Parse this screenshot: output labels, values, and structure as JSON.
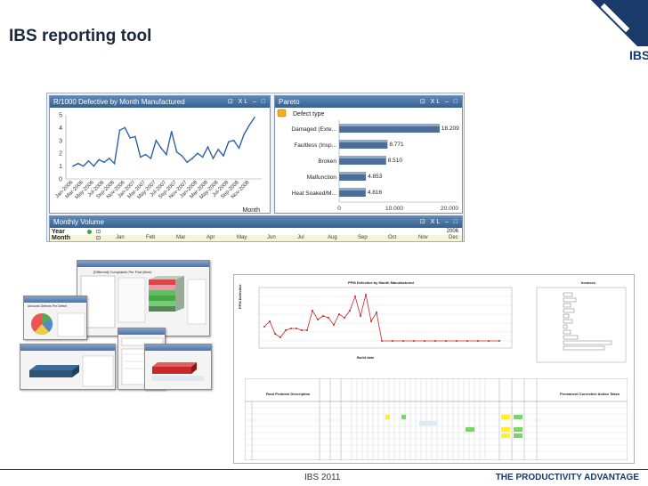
{
  "slide": {
    "title": "IBS reporting tool"
  },
  "logo": {
    "text": "IBS",
    "color": "#1a3a6a"
  },
  "qlikview": {
    "defective_panel": {
      "title": "R/1000 Defective by Month Manufactured",
      "icons": "⊡ XL ‒ □",
      "x_axis_label": "Month",
      "y_ticks": [
        "5",
        "4",
        "3",
        "2",
        "1",
        "0"
      ],
      "x_ticks": [
        "Jan-2006",
        "Mar-2006",
        "May-2006",
        "Jul-2006",
        "Sep-2006",
        "Nov-2006",
        "Jan-2007",
        "Mar-2007",
        "May-2007",
        "Jul-2007",
        "Sep-2007",
        "Nov-2007",
        "Jan-2008",
        "Mar-2008",
        "May-2008",
        "Jul-2008",
        "Sep-2008",
        "Nov-2008"
      ]
    },
    "pareto_panel": {
      "title": "Pareto",
      "icons": "⊡ XL ‒ □",
      "dimension_label": "Defect type",
      "x_ticks": [
        "0",
        "10.000",
        "20.000"
      ]
    },
    "monthly_volume": {
      "title": "Monthly Volume",
      "icons": "⊡ XL ‒ □",
      "year_label": "Year",
      "year_value": "2006",
      "month_label": "Month",
      "months": [
        "Jan",
        "Feb",
        "Mar",
        "Apr",
        "May",
        "Jun",
        "Jul",
        "Aug",
        "Sep",
        "Oct",
        "Nov",
        "Dec"
      ]
    }
  },
  "collage": {
    "caption": "[Different] Complaints Per Part (item)",
    "sub_caption": "Amounts Defects Per Defect"
  },
  "report": {
    "chart_title": "PPM Defective by Month Manufactured",
    "side_title": "Invoices",
    "x_axis_title": "Build date",
    "y_axis_title": "PPM Defective",
    "table_header": "Root Problem Description",
    "action_header": "Permanent Corrective Action Taken"
  },
  "chart_data": [
    {
      "type": "line",
      "title": "R/1000 Defective by Month Manufactured",
      "xlabel": "Month",
      "ylabel": "",
      "ylim": [
        0,
        5
      ],
      "x": [
        "Jan-2006",
        "Feb-2006",
        "Mar-2006",
        "Apr-2006",
        "May-2006",
        "Jun-2006",
        "Jul-2006",
        "Aug-2006",
        "Sep-2006",
        "Oct-2006",
        "Nov-2006",
        "Dec-2006",
        "Jan-2007",
        "Feb-2007",
        "Mar-2007",
        "Apr-2007",
        "May-2007",
        "Jun-2007",
        "Jul-2007",
        "Aug-2007",
        "Sep-2007",
        "Oct-2007",
        "Nov-2007",
        "Dec-2007",
        "Jan-2008",
        "Feb-2008",
        "Mar-2008",
        "Apr-2008",
        "May-2008",
        "Jun-2008",
        "Jul-2008",
        "Aug-2008",
        "Sep-2008",
        "Oct-2008",
        "Nov-2008",
        "Dec-2008"
      ],
      "series": [
        {
          "values": [
            1.0,
            1.2,
            1.0,
            1.4,
            1.0,
            1.5,
            1.3,
            1.6,
            1.2,
            3.8,
            4.0,
            3.2,
            3.3,
            1.7,
            1.9,
            1.6,
            3.0,
            2.4,
            1.9,
            3.7,
            2.1,
            1.8,
            1.3,
            1.6,
            2.0,
            1.7,
            2.5,
            1.6,
            2.3,
            1.8,
            2.9,
            3.0,
            2.4,
            3.5,
            4.2,
            4.8
          ]
        }
      ]
    },
    {
      "type": "bar",
      "title": "Pareto",
      "xlabel": "",
      "ylabel": "Defect type",
      "xlim": [
        0,
        20000
      ],
      "categories": [
        "Damaged (Exte...",
        "Faultless (Insp...",
        "Broken",
        "Malfunction",
        "Heat Soaked/M..."
      ],
      "values": [
        18209,
        8771,
        8510,
        4853,
        4816
      ],
      "data_labels": [
        "18.209",
        "8.771",
        "8.510",
        "4.853",
        "4.816"
      ]
    }
  ],
  "footer": {
    "center": "IBS 2011",
    "right": "THE PRODUCTIVITY ADVANTAGE"
  }
}
